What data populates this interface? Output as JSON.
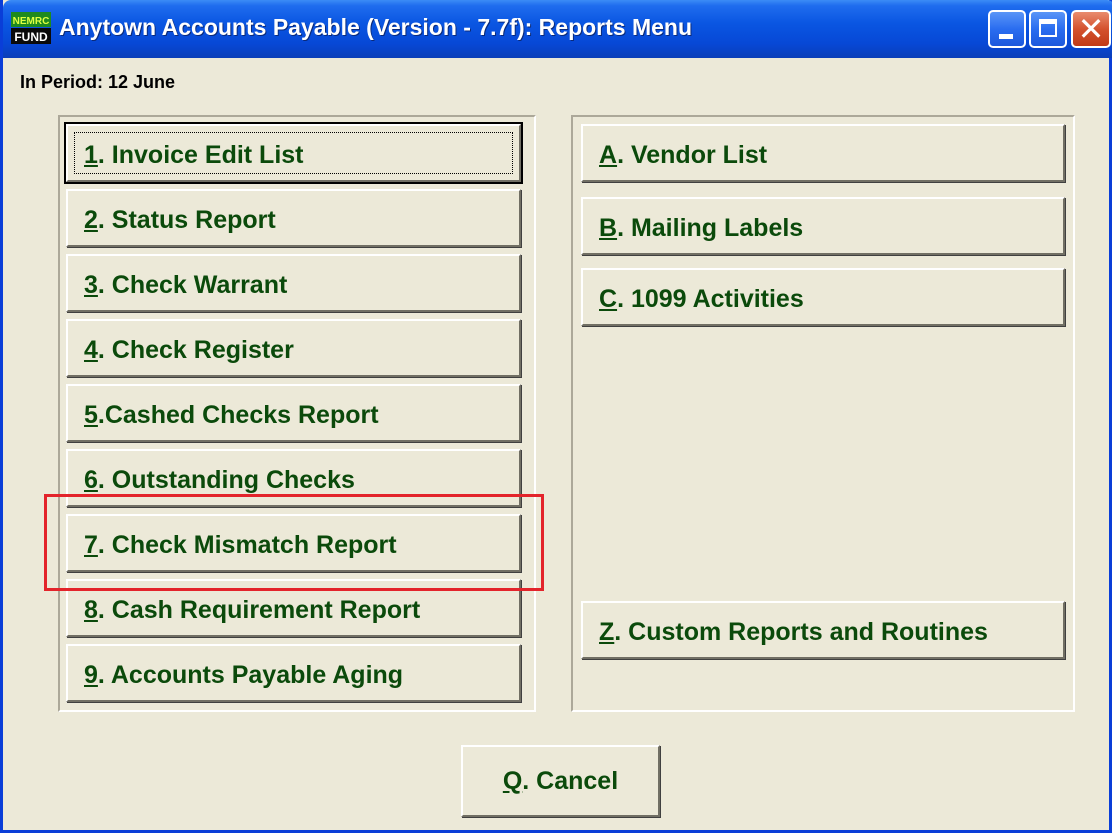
{
  "window": {
    "title": "Anytown Accounts Payable (Version - 7.7f):  Reports Menu",
    "period_label": "In Period: 12 June",
    "icon_top": "NEMRC",
    "icon_bottom": "FUND"
  },
  "left_menu": [
    {
      "key": "1",
      "rest": ".  Invoice Edit List"
    },
    {
      "key": "2",
      "rest": ". Status Report"
    },
    {
      "key": "3",
      "rest": ". Check Warrant"
    },
    {
      "key": "4",
      "rest": ". Check Register"
    },
    {
      "key": "5",
      "rest": ".Cashed Checks Report"
    },
    {
      "key": "6",
      "rest": ". Outstanding Checks"
    },
    {
      "key": "7",
      "rest": ". Check Mismatch Report"
    },
    {
      "key": "8",
      "rest": ". Cash Requirement Report"
    },
    {
      "key": "9",
      "rest": ".  Accounts Payable Aging"
    }
  ],
  "right_menu": [
    {
      "key": "A",
      "rest": ". Vendor List"
    },
    {
      "key": "B",
      "rest": ". Mailing Labels"
    },
    {
      "key": "C",
      "rest": ".  1099 Activities"
    },
    {
      "key": "Z",
      "rest": ".  Custom Reports and Routines"
    }
  ],
  "cancel": {
    "key": "Q",
    "rest": ". Cancel"
  },
  "colors": {
    "button_text": "#0b4a0b",
    "highlight_box": "#e3242b",
    "titlebar": "#0a56e2"
  }
}
